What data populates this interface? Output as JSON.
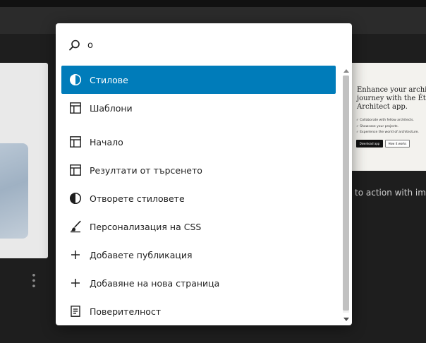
{
  "search": {
    "value": "o",
    "placeholder": ""
  },
  "results": [
    {
      "label": "Стилове",
      "icon": "contrast-icon",
      "selected": true
    },
    {
      "label": "Шаблони",
      "icon": "layout-icon",
      "selected": false
    },
    {
      "label": "Начало",
      "icon": "layout-icon",
      "selected": false
    },
    {
      "label": "Резултати от търсенето",
      "icon": "layout-icon",
      "selected": false
    },
    {
      "label": "Отворете стиловете",
      "icon": "contrast-icon",
      "selected": false
    },
    {
      "label": "Персонализация на CSS",
      "icon": "brush-icon",
      "selected": false
    },
    {
      "label": "Добавете публикация",
      "icon": "plus-icon",
      "selected": false
    },
    {
      "label": "Добавяне на нова страница",
      "icon": "plus-icon",
      "selected": false
    },
    {
      "label": "Поверителност",
      "icon": "page-icon",
      "selected": false
    }
  ],
  "background": {
    "promo": {
      "heading_lines": [
        "Enhance your archite",
        "journey with the Étu",
        "Architect app."
      ],
      "bullets": [
        "Collaborate with fellow architects.",
        "Showcase your projects.",
        "Experience the world of architecture."
      ],
      "primary_button": "Download app",
      "secondary_button": "How it works"
    },
    "caption": "to action with ima"
  },
  "colors": {
    "accent": "#007cba",
    "background": "#1e1e1e"
  }
}
